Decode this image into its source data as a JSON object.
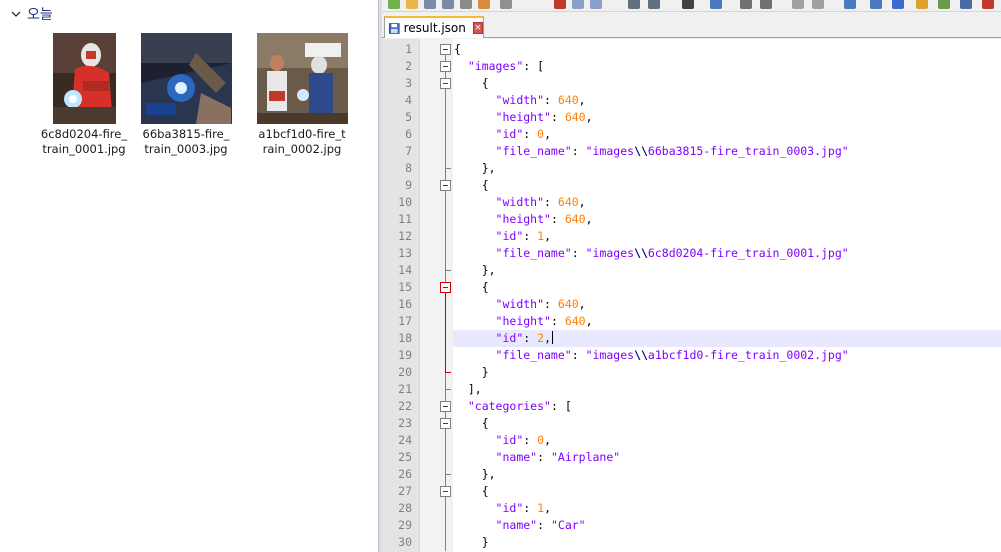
{
  "explorer": {
    "group_title": "오늘",
    "files": [
      {
        "name": "6c8d0204-fire_train_0001.jpg"
      },
      {
        "name": "66ba3815-fire_train_0003.jpg"
      },
      {
        "name": "a1bcf1d0-fire_train_0002.jpg"
      }
    ]
  },
  "editor": {
    "tab_label": "result.json",
    "tab_close": "×",
    "current_line": 18,
    "lines": [
      {
        "n": "1",
        "text": "{"
      },
      {
        "n": "2",
        "text": "  \"images\": ["
      },
      {
        "n": "3",
        "text": "    {"
      },
      {
        "n": "4",
        "text": "      \"width\": 640,"
      },
      {
        "n": "5",
        "text": "      \"height\": 640,"
      },
      {
        "n": "6",
        "text": "      \"id\": 0,"
      },
      {
        "n": "7",
        "text": "      \"file_name\": \"images\\\\66ba3815-fire_train_0003.jpg\""
      },
      {
        "n": "8",
        "text": "    },"
      },
      {
        "n": "9",
        "text": "    {"
      },
      {
        "n": "10",
        "text": "      \"width\": 640,"
      },
      {
        "n": "11",
        "text": "      \"height\": 640,"
      },
      {
        "n": "12",
        "text": "      \"id\": 1,"
      },
      {
        "n": "13",
        "text": "      \"file_name\": \"images\\\\6c8d0204-fire_train_0001.jpg\""
      },
      {
        "n": "14",
        "text": "    },"
      },
      {
        "n": "15",
        "text": "    {"
      },
      {
        "n": "16",
        "text": "      \"width\": 640,"
      },
      {
        "n": "17",
        "text": "      \"height\": 640,"
      },
      {
        "n": "18",
        "text": "      \"id\": 2,"
      },
      {
        "n": "19",
        "text": "      \"file_name\": \"images\\\\a1bcf1d0-fire_train_0002.jpg\""
      },
      {
        "n": "20",
        "text": "    }"
      },
      {
        "n": "21",
        "text": "  ],"
      },
      {
        "n": "22",
        "text": "  \"categories\": ["
      },
      {
        "n": "23",
        "text": "    {"
      },
      {
        "n": "24",
        "text": "      \"id\": 0,"
      },
      {
        "n": "25",
        "text": "      \"name\": \"Airplane\""
      },
      {
        "n": "26",
        "text": "    },"
      },
      {
        "n": "27",
        "text": "    {"
      },
      {
        "n": "28",
        "text": "      \"id\": 1,"
      },
      {
        "n": "29",
        "text": "      \"name\": \"Car\""
      },
      {
        "n": "30",
        "text": "    }"
      }
    ]
  },
  "colors": {
    "key": "#8000ff",
    "number": "#ff8000",
    "tab_accent": "#f7b934",
    "fold_active": "#cc0000",
    "current_line_bg": "#e8e8ff"
  }
}
